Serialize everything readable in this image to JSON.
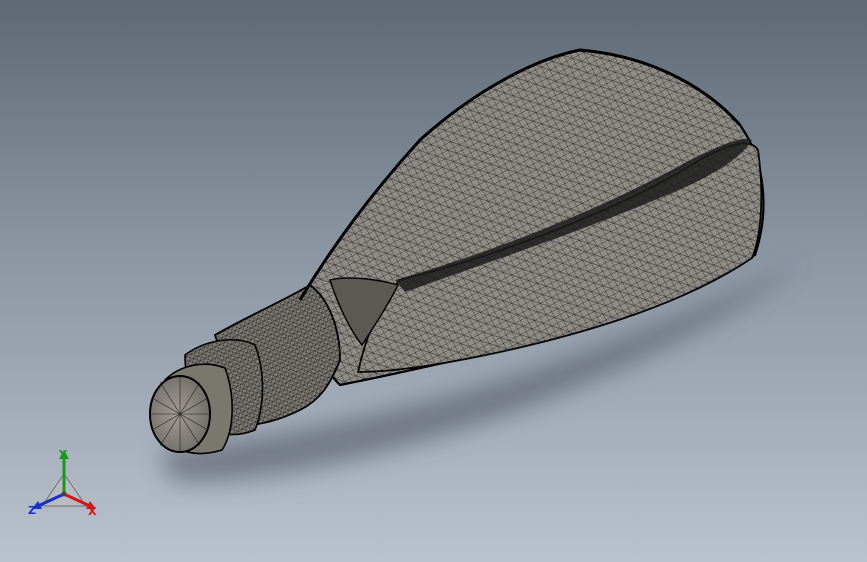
{
  "viewport": {
    "model": "bottle-mesh",
    "colors": {
      "background_top": "#5f6875",
      "background_bottom": "#b9c2cd",
      "mesh_fill": "#8f8c86",
      "mesh_line": "#111111",
      "shadow": "#4a505a"
    }
  },
  "triad": {
    "x_label": "X",
    "y_label": "Y",
    "z_label": "Z",
    "colors": {
      "x": "#d01818",
      "y": "#1a9a1a",
      "z": "#1830c8"
    }
  }
}
